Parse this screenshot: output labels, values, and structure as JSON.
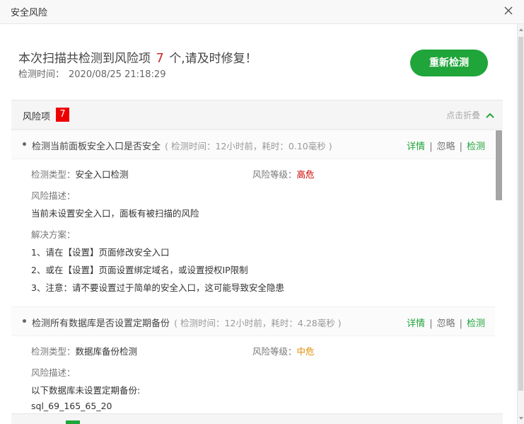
{
  "window": {
    "title": "安全风险"
  },
  "summary": {
    "headline_prefix": "本次扫描共检测到风险项",
    "risk_count": "7",
    "headline_suffix": "个,请及时修复！",
    "time_label": "检测时间：",
    "time_value": "2020/08/25 21:18:29",
    "recheck_label": "重新检测"
  },
  "risk_panel": {
    "label": "风险项",
    "count": "7",
    "fold_label": "点击折叠"
  },
  "items": [
    {
      "title": "检测当前面板安全入口是否安全",
      "meta": "( 检测时间：12小时前，耗时：0.10毫秒 )",
      "actions": {
        "detail": "详情",
        "ignore": "忽略",
        "check": "检测"
      },
      "type_label": "检测类型：",
      "type_value": "安全入口检测",
      "level_label": "风险等级：",
      "level_value": "高危",
      "desc_label": "风险描述：",
      "desc_value": "当前未设置安全入口，面板有被扫描的风险",
      "solution_label": "解决方案：",
      "solutions": [
        "1、请在【设置】页面修改安全入口",
        "2、或在【设置】页面设置绑定域名，或设置授权IP限制",
        "3、注意：请不要设置过于简单的安全入口，这可能导致安全隐患"
      ]
    },
    {
      "title": "检测所有数据库是否设置定期备份",
      "meta": "( 检测时间：12小时前，耗时：4.28毫秒 )",
      "actions": {
        "detail": "详情",
        "ignore": "忽略",
        "check": "检测"
      },
      "type_label": "检测类型：",
      "type_value": "数据库备份检测",
      "level_label": "风险等级：",
      "level_value": "中危",
      "desc_label": "风险描述：",
      "desc_value": "以下数据库未设置定期备份:",
      "desc_extra": "sql_69_165_65_20"
    }
  ],
  "colors": {
    "accent": "#20a53a",
    "danger": "#ef0000",
    "high": "#d10000",
    "medium": "#e08c00"
  }
}
